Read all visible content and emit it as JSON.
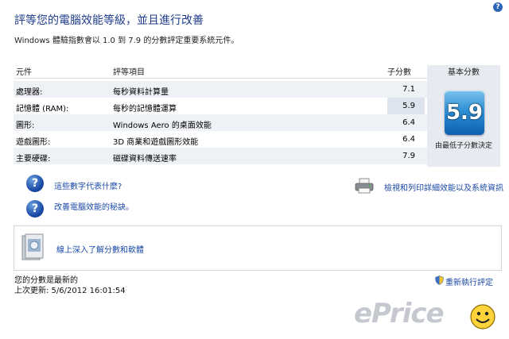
{
  "header": {
    "title": "評等您的電腦效能等級，並且進行改善",
    "subtitle": "Windows 體驗指數會以 1.0 到 7.9 的分數評定重要系統元件。",
    "help_label": "?"
  },
  "table": {
    "col_component": "元件",
    "col_rated": "評等項目",
    "col_subscore": "子分數",
    "col_base": "基本分數",
    "rows": [
      {
        "component": "處理器:",
        "rated": "每秒資料計算量",
        "score": "7.1"
      },
      {
        "component": "記憶體 (RAM):",
        "rated": "每秒的記憶體運算",
        "score": "5.9"
      },
      {
        "component": "圖形:",
        "rated": "Windows Aero 的桌面效能",
        "score": "6.4"
      },
      {
        "component": "遊戲圖形:",
        "rated": "3D 商業和遊戲圖形效能",
        "score": "6.4"
      },
      {
        "component": "主要硬碟:",
        "rated": "磁碟資料傳送速率",
        "score": "7.9"
      }
    ],
    "base_score": "5.9",
    "base_caption": "由最低子分數決定"
  },
  "links": {
    "what_mean": "這些數字代表什麼?",
    "tips": "改善電腦效能的秘訣。",
    "print": "檢視和列印詳細效能以及系統資訊",
    "learn_more": "線上深入了解分數和軟體"
  },
  "status": {
    "current": "您的分數是最新的",
    "last_update": "上次更新: 5/6/2012 16:01:54",
    "rerun": "重新執行評定"
  },
  "watermark": "ePrice",
  "colors": {
    "title": "#1e3c8c",
    "link": "#1b4aa8",
    "row_alt": "#eef1f5",
    "base_column": "#e7eaf0"
  }
}
